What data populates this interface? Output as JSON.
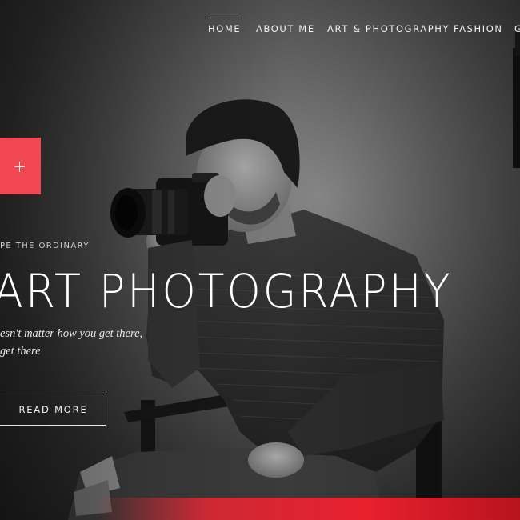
{
  "nav": {
    "items": [
      {
        "label": "HOME",
        "active": true
      },
      {
        "label": "ABOUT ME",
        "active": false
      },
      {
        "label": "ART & PHOTOGRAPHY",
        "active": false
      },
      {
        "label": "FASHION",
        "active": false
      },
      {
        "label": "G",
        "active": false
      }
    ]
  },
  "side_button": {
    "icon": "plus-icon",
    "label": "+",
    "color": "#f04752"
  },
  "hero": {
    "eyebrow": "PE THE ORDINARY",
    "title": "ART PHOTOGRAPHY",
    "tagline_line1": "esn't matter how you get there,",
    "tagline_line2": "get there",
    "cta_label": "READ MORE"
  },
  "colors": {
    "accent": "#f04752",
    "text": "#ffffff"
  }
}
